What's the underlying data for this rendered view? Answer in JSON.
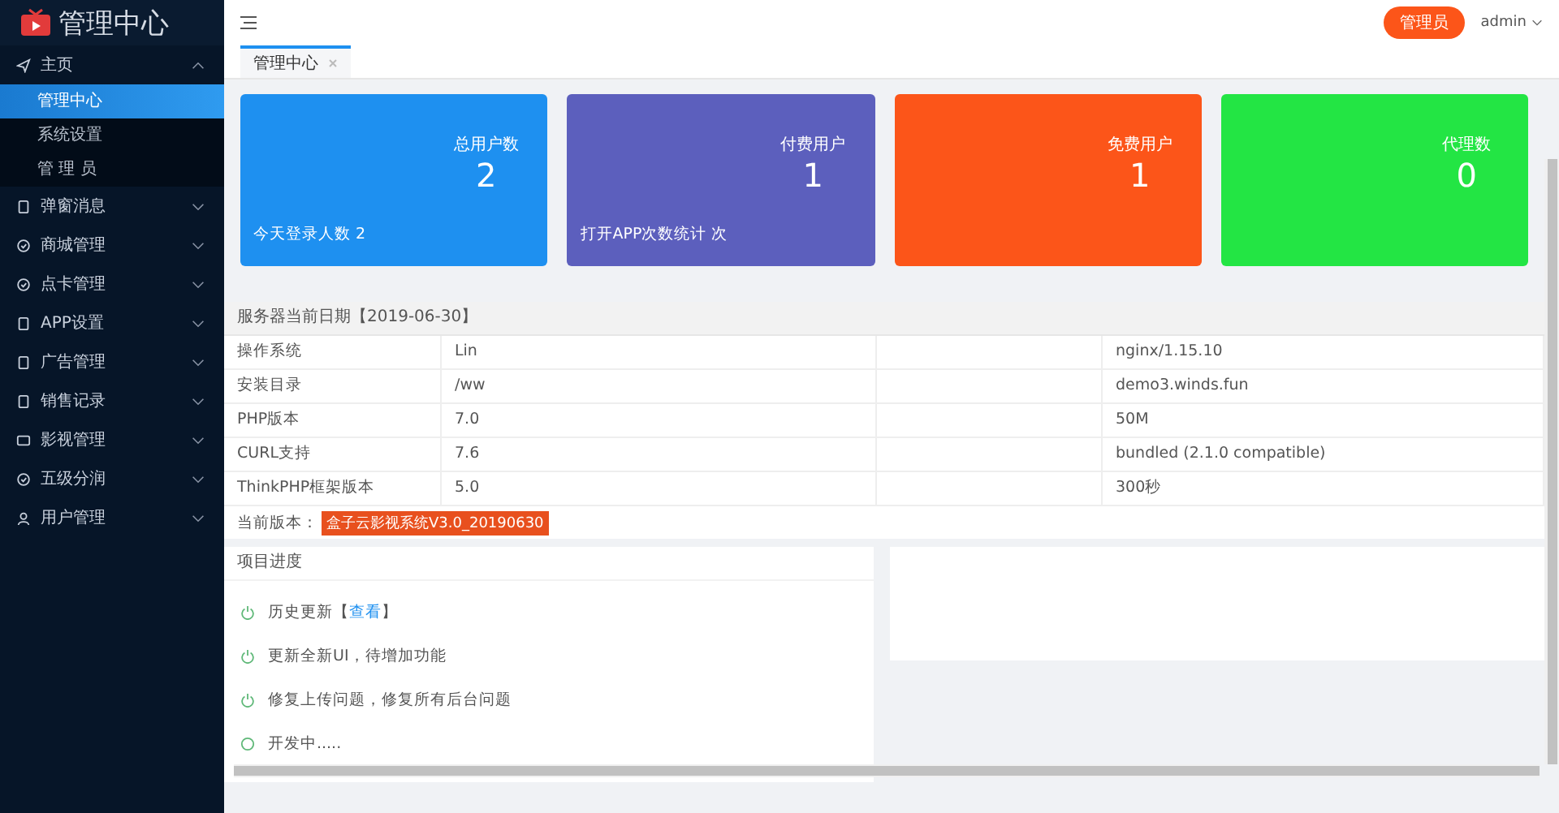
{
  "logo": {
    "title": "管理中心"
  },
  "sidebar": {
    "items": [
      {
        "label": "主页",
        "expanded": true,
        "children": [
          {
            "label": "管理中心",
            "selected": true
          },
          {
            "label": "系统设置",
            "selected": false
          },
          {
            "label": "管 理 员",
            "selected": false
          }
        ]
      },
      {
        "label": "弹窗消息",
        "expanded": false
      },
      {
        "label": "商城管理",
        "expanded": false
      },
      {
        "label": "点卡管理",
        "expanded": false
      },
      {
        "label": "APP设置",
        "expanded": false
      },
      {
        "label": "广告管理",
        "expanded": false
      },
      {
        "label": "销售记录",
        "expanded": false
      },
      {
        "label": "影视管理",
        "expanded": false
      },
      {
        "label": "五级分润",
        "expanded": false
      },
      {
        "label": "用户管理",
        "expanded": false
      }
    ]
  },
  "header": {
    "role_badge": "管理员",
    "user": "admin"
  },
  "tabs": [
    {
      "label": "管理中心",
      "selected": true
    }
  ],
  "cards": [
    {
      "title": "总用户数",
      "value": "2",
      "note": "今天登录人数 2",
      "color": "#1e90f0"
    },
    {
      "title": "付费用户",
      "value": "1",
      "note": "打开APP次数统计 次",
      "color": "#5c5fbd"
    },
    {
      "title": "免费用户",
      "value": "1",
      "color": "#fc5519"
    },
    {
      "title": "代理数",
      "value": "0",
      "color": "#23e544"
    }
  ],
  "server": {
    "title": "服务器当前日期【2019-06-30】",
    "rows": [
      {
        "column_1": "操作系统",
        "column_2": "Lin",
        "column_4": "nginx/1.15.10"
      },
      {
        "column_1": "安装目录",
        "column_2": "/ww",
        "column_4": "demo3.winds.fun"
      },
      {
        "column_1": "PHP版本",
        "column_2": "7.0",
        "column_4": "50M"
      },
      {
        "column_1": "CURL支持",
        "column_2": "7.6",
        "column_4": "bundled (2.1.0 compatible)"
      },
      {
        "column_1": "ThinkPHP框架版本",
        "column_2": "5.0",
        "column_4": "300秒"
      }
    ],
    "version_label": "当前版本：",
    "version": "盒子云影视系统V3.0_20190630"
  },
  "progress": {
    "title": "项目进度",
    "items": [
      {
        "text": "历史更新【",
        "link": "查看",
        "after": "】",
        "done": true
      },
      {
        "text": "更新全新UI，待增加功能",
        "done": true
      },
      {
        "text": "修复上传问题，修复所有后台问题",
        "done": true
      },
      {
        "text": "开发中.....",
        "done": false
      }
    ]
  }
}
